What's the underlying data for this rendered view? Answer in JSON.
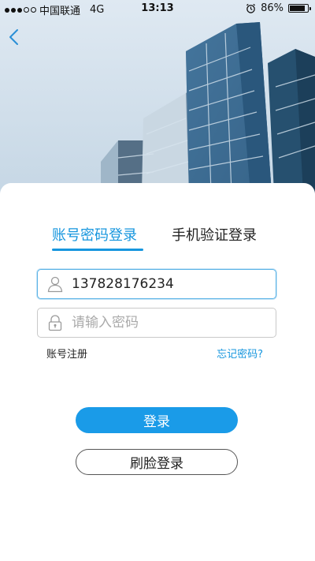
{
  "status_bar": {
    "carrier": "中国联通",
    "network": "4G",
    "time": "13:13",
    "battery": "86%",
    "battery_level": 0.86,
    "signal_bars_filled": 3,
    "signal_bars_total": 5
  },
  "nav": {
    "back_icon": "chevron-left-icon"
  },
  "tabs": [
    {
      "label": "账号密码登录",
      "active": true
    },
    {
      "label": "手机验证登录",
      "active": false
    }
  ],
  "form": {
    "username": {
      "value": "137828176234",
      "icon": "user-icon"
    },
    "password": {
      "value": "",
      "placeholder": "请输入密码",
      "icon": "lock-icon"
    }
  },
  "links": {
    "register": "账号注册",
    "forgot": "忘记密码?"
  },
  "buttons": {
    "login": "登录",
    "face_login": "刷脸登录"
  },
  "colors": {
    "accent": "#1a9be8",
    "tab_active": "#1696de"
  }
}
